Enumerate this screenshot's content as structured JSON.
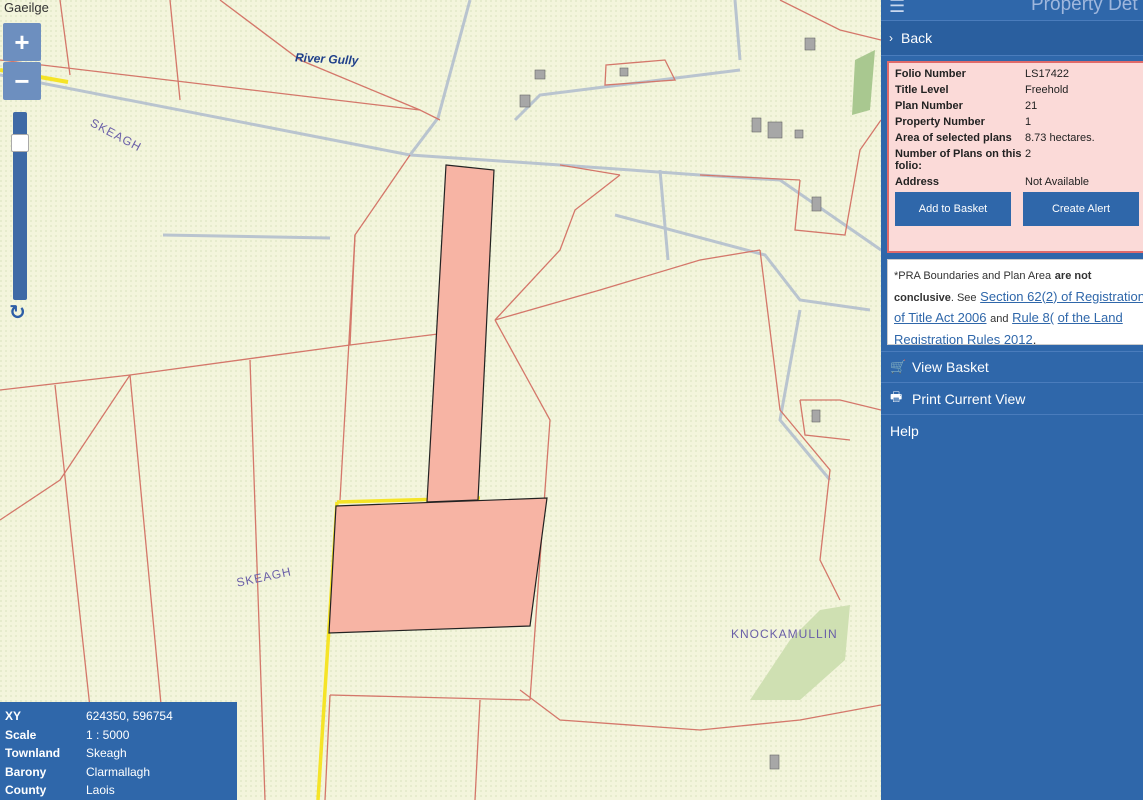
{
  "header": {
    "language_link": "Gaeilge",
    "panel_title": "Property Det",
    "menu_icon": "hamburger-icon"
  },
  "zoom": {
    "in_label": "+",
    "out_label": "−",
    "refresh_icon": "↻"
  },
  "map_labels": {
    "river": "River Gully",
    "townland_1": "SKEAGH",
    "townland_2": "SKEAGH",
    "townland_3": "KNOCKAMULLIN"
  },
  "info": {
    "rows": [
      {
        "key": "XY",
        "value": "624350, 596754"
      },
      {
        "key": "Scale",
        "value": "1 : 5000"
      },
      {
        "key": "Townland",
        "value": "Skeagh"
      },
      {
        "key": "Barony",
        "value": "Clarmallagh"
      },
      {
        "key": "County",
        "value": "Laois"
      }
    ]
  },
  "panel": {
    "back_label": "Back",
    "details": [
      {
        "key": "Folio Number",
        "value": "LS17422"
      },
      {
        "key": "Title Level",
        "value": "Freehold"
      },
      {
        "key": "Plan Number",
        "value": "21"
      },
      {
        "key": "Property Number",
        "value": "1"
      },
      {
        "key": "Area of selected plans",
        "value": "8.73 hectares."
      },
      {
        "key": "Number of Plans on this folio:",
        "value": "2"
      },
      {
        "key": "Address",
        "value": "Not Available"
      }
    ],
    "add_to_basket": "Add to Basket",
    "create_alert": "Create Alert",
    "disclaimer": {
      "lead": "*PRA Boundaries and Plan Area",
      "bold": "are not conclusive",
      "see": ". See",
      "link1": "Section 62(2) of Registration of Title Act 2006",
      "and": "and",
      "link2": "Rule 8(",
      "link2b": "of the Land Registration Rules 2012",
      "end": "."
    },
    "menu": [
      {
        "icon": "cart-icon",
        "glyph": "🛒",
        "label": "View Basket"
      },
      {
        "icon": "print-icon",
        "glyph": "🖶",
        "label": "Print Current View"
      },
      {
        "icon": "",
        "glyph": "",
        "label": "Help"
      }
    ]
  },
  "colors": {
    "panel_bg": "#2f67aa",
    "parcel_fill": "#f7b4a4",
    "boundary_red": "#d4776a",
    "highlight_yellow": "#f5e427",
    "map_bg": "#f2f4de"
  }
}
